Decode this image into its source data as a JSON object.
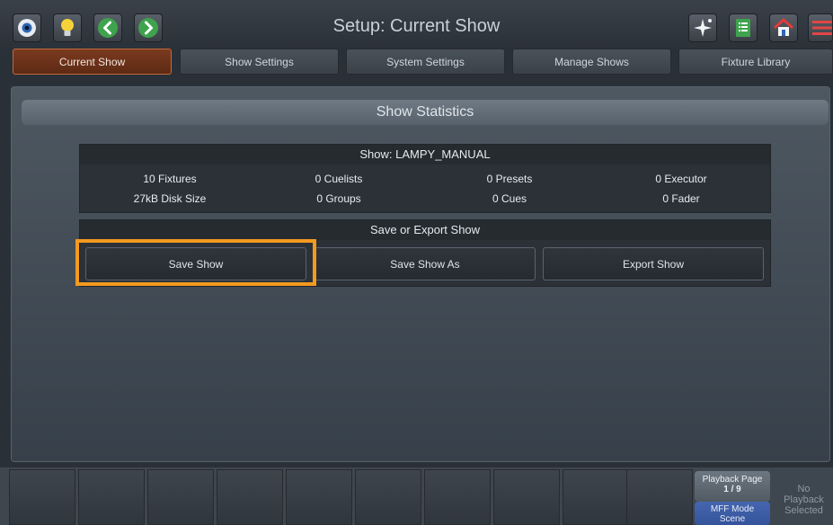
{
  "header": {
    "title": "Setup: Current Show",
    "left_icons": [
      "eye-icon",
      "lightbulb-icon",
      "chevron-left-icon",
      "chevron-right-icon"
    ],
    "right_icons": [
      "sparkle-icon",
      "notes-icon",
      "home-icon",
      "menu-icon"
    ]
  },
  "tabs": [
    {
      "label": "Current Show",
      "active": true
    },
    {
      "label": "Show Settings",
      "active": false
    },
    {
      "label": "System Settings",
      "active": false
    },
    {
      "label": "Manage Shows",
      "active": false
    },
    {
      "label": "Fixture Library",
      "active": false
    }
  ],
  "main": {
    "section_title": "Show Statistics",
    "show_name": "Show: LAMPY_MANUAL",
    "stats_row1": [
      "10 Fixtures",
      "0 Cuelists",
      "0 Presets",
      "0 Executor"
    ],
    "stats_row2": [
      "27kB Disk Size",
      "0 Groups",
      "0 Cues",
      "0 Fader"
    ],
    "save_section_title": "Save or Export Show",
    "buttons": {
      "save": "Save Show",
      "save_as": "Save Show As",
      "export": "Export Show"
    }
  },
  "bottom": {
    "playback_page_label": "Playback Page",
    "playback_page_value": "1 / 9",
    "mff_mode_label": "MFF Mode",
    "mff_mode_value": "Scene",
    "no_playback_line1": "No",
    "no_playback_line2": "Playback",
    "no_playback_line3": "Selected"
  },
  "colors": {
    "highlight": "#f39a1f",
    "active_tab": "#7a3a1f",
    "green_button": "#3fa34d"
  }
}
